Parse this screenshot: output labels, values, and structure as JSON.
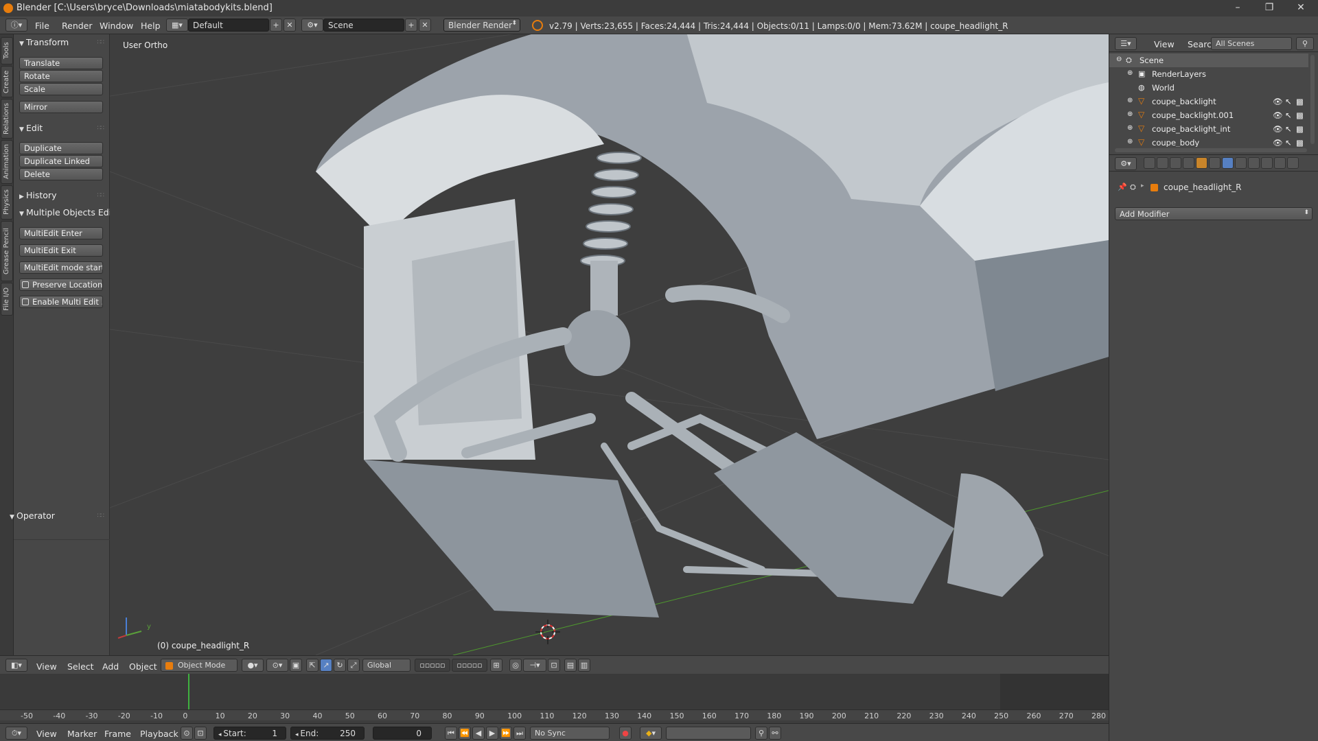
{
  "titlebar": {
    "title": "Blender [C:\\Users\\bryce\\Downloads\\miatabodykits.blend]",
    "minimize": "–",
    "maximize": "❐",
    "close": "✕"
  },
  "infobar": {
    "menus": [
      "File",
      "Render",
      "Window",
      "Help"
    ],
    "layout": "Default",
    "scene": "Scene",
    "engine": "Blender Render",
    "stats": "v2.79 | Verts:23,655 | Faces:24,444 | Tris:24,444 | Objects:0/11 | Lamps:0/0 | Mem:73.62M | coupe_headlight_R"
  },
  "left_tabs": [
    "Tools",
    "Create",
    "Relations",
    "Animation",
    "Physics",
    "Grease Pencil",
    "File I/O"
  ],
  "toolshelf": {
    "transform": {
      "label": "Transform",
      "buttons": [
        "Translate",
        "Rotate",
        "Scale"
      ],
      "mirror": "Mirror"
    },
    "edit": {
      "label": "Edit",
      "buttons": [
        "Duplicate",
        "Duplicate Linked",
        "Delete"
      ]
    },
    "history": {
      "label": "History"
    },
    "multi": {
      "label": "Multiple Objects Edit",
      "buttons": [
        "MultiEdit Enter",
        "MultiEdit Exit",
        "MultiEdit mode start",
        "Preserve Location/...",
        "Enable Multi Edit ..."
      ]
    },
    "operator": {
      "label": "Operator"
    }
  },
  "viewport": {
    "view_name": "User Ortho",
    "object_label": "(0) coupe_headlight_R",
    "axis_x": "x",
    "axis_y": "y"
  },
  "view_header": {
    "menus": [
      "View",
      "Select",
      "Add",
      "Object"
    ],
    "mode": "Object Mode",
    "orientation": "Global"
  },
  "timeline": {
    "ticks": [
      "-50",
      "-40",
      "-30",
      "-20",
      "-10",
      "0",
      "10",
      "20",
      "30",
      "40",
      "50",
      "60",
      "70",
      "80",
      "90",
      "100",
      "110",
      "120",
      "130",
      "140",
      "150",
      "160",
      "170",
      "180",
      "190",
      "200",
      "210",
      "220",
      "230",
      "240",
      "250",
      "260",
      "270",
      "280"
    ],
    "current_frame": 0
  },
  "timeline_header": {
    "menus": [
      "View",
      "Marker",
      "Frame",
      "Playback"
    ],
    "start_label": "Start:",
    "start": "1",
    "end_label": "End:",
    "end": "250",
    "frame": "0",
    "sync": "No Sync"
  },
  "outliner": {
    "menus": [
      "View",
      "Search"
    ],
    "filter": "All Scenes",
    "rows": [
      "Scene",
      "RenderLayers",
      "World",
      "coupe_backlight",
      "coupe_backlight.001",
      "coupe_backlight_int",
      "coupe_body"
    ]
  },
  "properties": {
    "object": "coupe_headlight_R",
    "add_modifier": "Add Modifier"
  },
  "colors": {
    "accent": "#5680c2",
    "object_orange": "#e87d0d",
    "current_frame": "#3fb13f",
    "x_axis": "#b23c3c",
    "y_axis": "#5aa13a"
  }
}
